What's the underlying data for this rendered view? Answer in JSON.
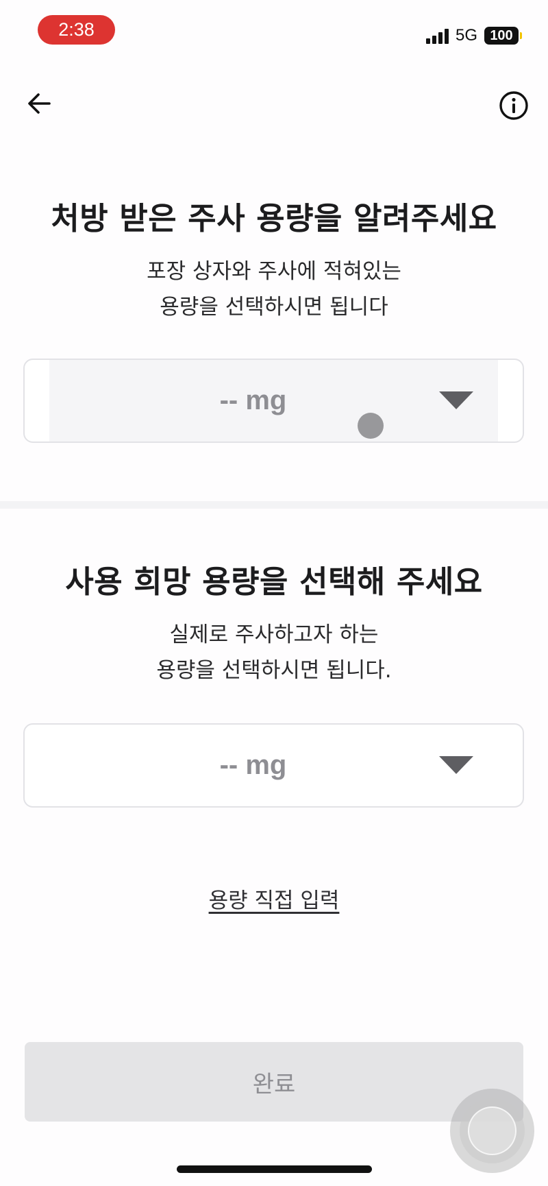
{
  "status_bar": {
    "time": "2:38",
    "network": "5G",
    "battery": "100",
    "icons": [
      "signal-icon",
      "battery-icon"
    ]
  },
  "nav": {
    "back_icon": "arrow-left-icon",
    "info_icon": "info-circle-icon"
  },
  "prescribed": {
    "title": "처방 받은 주사 용량을 알려주세요",
    "subtitle_line1": "포장 상자와 주사에 적혀있는",
    "subtitle_line2": "용량을 선택하시면 됩니다",
    "select_value": "-- mg"
  },
  "desired": {
    "title": "사용 희망 용량을 선택해 주세요",
    "subtitle_line1": "실제로 주사하고자 하는",
    "subtitle_line2": "용량을 선택하시면 됩니다.",
    "select_value": "-- mg"
  },
  "direct_input_link": "용량 직접 입력",
  "complete_button": "완료",
  "colors": {
    "time_pill": "#dd3431",
    "button_disabled_bg": "#e4e4e6",
    "placeholder_text": "#8e8e93"
  }
}
